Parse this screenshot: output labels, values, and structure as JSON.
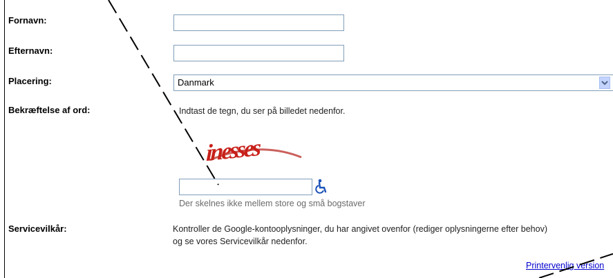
{
  "form": {
    "first_name": {
      "label": "Fornavn:",
      "value": ""
    },
    "last_name": {
      "label": "Efternavn:",
      "value": ""
    },
    "location": {
      "label": "Placering:",
      "selected": "Danmark"
    },
    "captcha": {
      "label": "Bekræftelse af ord:",
      "instruction": "Indtast de tegn, du ser på billedet nedenfor.",
      "image_text": "inesses",
      "value": "",
      "hint": "Der skelnes ikke mellem store og små bogstaver"
    },
    "tos": {
      "label": "Servicevilkår:",
      "line1": "Kontroller de Google-kontooplysninger, du har angivet ovenfor (rediger oplysningerne efter behov)",
      "line2": "og se vores Servicevilkår nedenfor.",
      "print_link": "Printervenlig version"
    }
  },
  "icons": {
    "accessibility": "wheelchair-icon",
    "dropdown": "chevron-down-icon"
  },
  "colors": {
    "input_border": "#7f9db9",
    "captcha_red": "#c8201a",
    "link": "#0000cc"
  }
}
